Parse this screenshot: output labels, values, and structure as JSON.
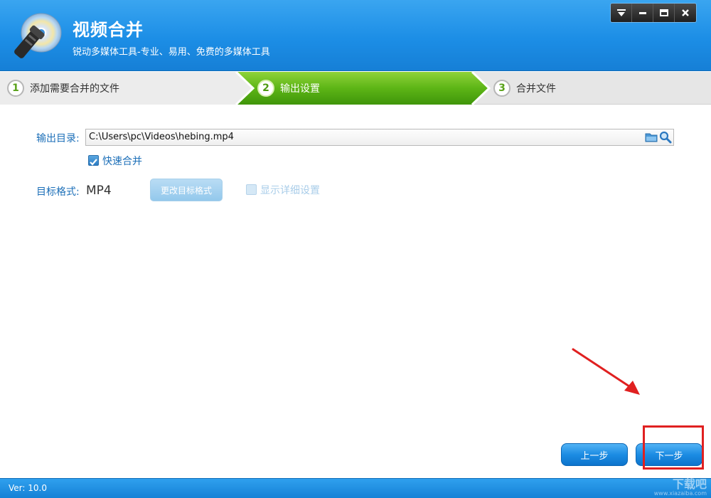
{
  "app": {
    "title": "视频合并",
    "subtitle": "锐动多媒体工具-专业、易用、免费的多媒体工具"
  },
  "window_controls": [
    "menu",
    "minimize",
    "maximize",
    "close"
  ],
  "steps": [
    {
      "number": "1",
      "label": "添加需要合并的文件",
      "active": false
    },
    {
      "number": "2",
      "label": "输出设置",
      "active": true
    },
    {
      "number": "3",
      "label": "合并文件",
      "active": false
    }
  ],
  "output": {
    "label": "输出目录:",
    "path": "C:\\Users\\pc\\Videos\\hebing.mp4",
    "fast_merge_label": "快速合并",
    "fast_merge_checked": true
  },
  "format": {
    "label": "目标格式:",
    "value": "MP4",
    "change_button": "更改目标格式",
    "show_details_label": "显示详细设置",
    "show_details_checked": false
  },
  "nav": {
    "prev": "上一步",
    "next": "下一步"
  },
  "status": {
    "version": "Ver: 10.0"
  },
  "watermark": {
    "text": "下载吧",
    "url": "www.xiazaiba.com"
  },
  "colors": {
    "title_blue": "#1c8ee6",
    "step_active_green": "#55aa12",
    "label_blue": "#1c6fb8",
    "highlight_red": "#e02020"
  }
}
